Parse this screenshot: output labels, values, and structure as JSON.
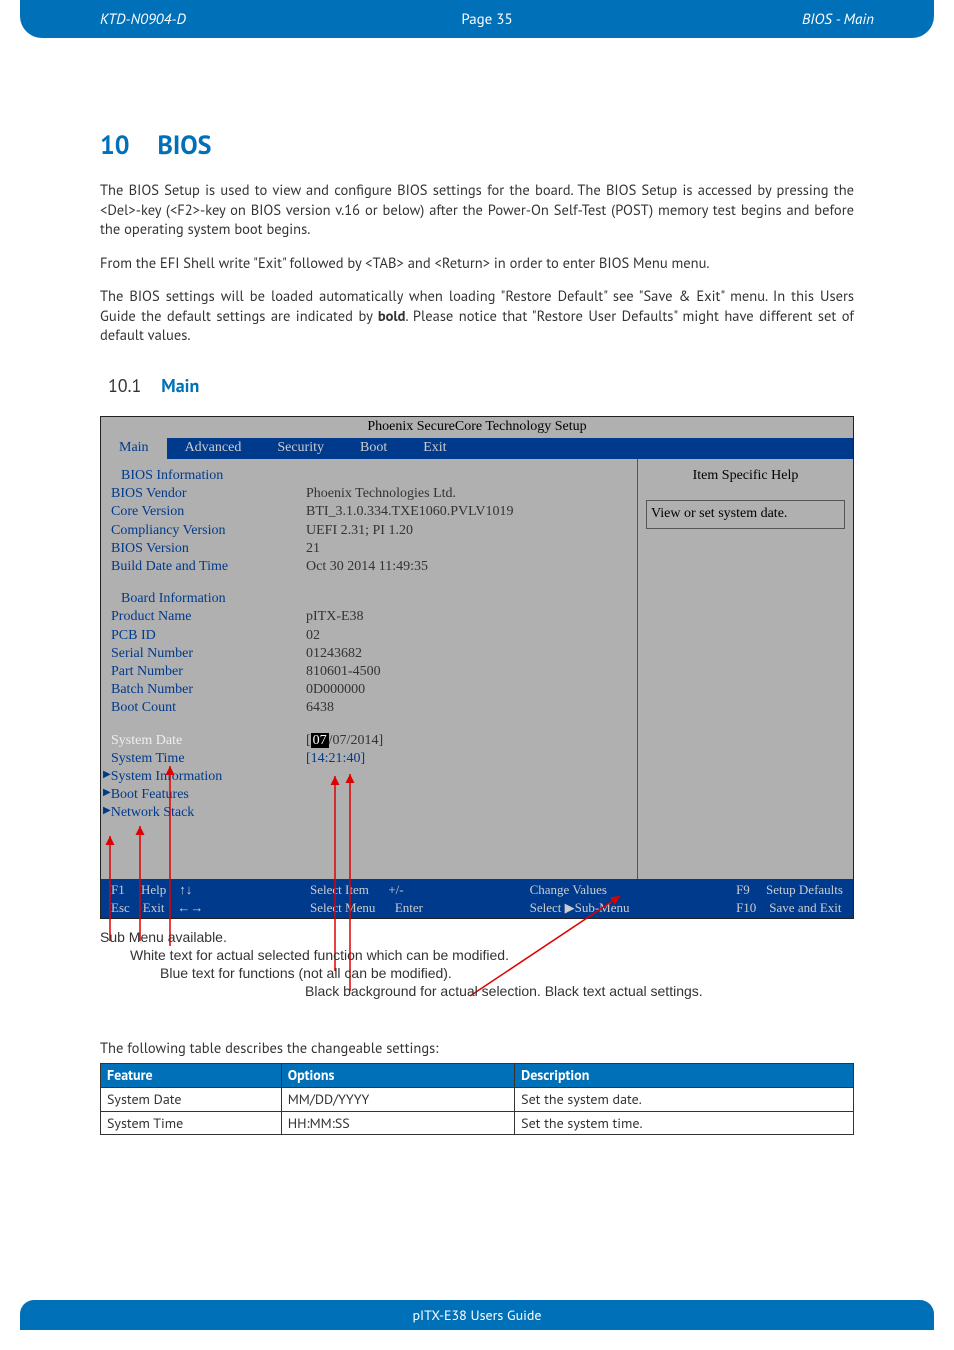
{
  "header": {
    "left": "KTD-N0904-D",
    "center": "Page 35",
    "right": "BIOS  - Main"
  },
  "section": {
    "num": "10",
    "title": "BIOS"
  },
  "para1": "The BIOS Setup is used to view and configure BIOS settings for the board. The BIOS Setup is accessed by pressing the <Del>-key (<F2>-key on BIOS version v.16 or below) after the Power-On Self-Test (POST) memory test begins and before the operating system boot begins.",
  "para2": "From the EFI Shell write \"Exit\" followed by <TAB> and <Return> in order to enter BIOS Menu menu.",
  "para3a": "The BIOS settings will be loaded automatically when loading \"Restore Default\" see \"Save & Exit\" menu. In this Users Guide the default settings are indicated by ",
  "para3b": "bold",
  "para3c": ".  Please notice that \"Restore User Defaults\" might have different set of default values.",
  "subsection": {
    "num": "10.1",
    "title": "Main"
  },
  "bios": {
    "title": "Phoenix SecureCore Technology Setup",
    "tabs": [
      "Main",
      "Advanced",
      "Security",
      "Boot",
      "Exit"
    ],
    "help_title": "Item Specific Help",
    "help_text": "View or set system date.",
    "sections": {
      "bios_info_hdr": "BIOS Information",
      "bios_vendor_l": "BIOS Vendor",
      "bios_vendor_v": "Phoenix Technologies Ltd.",
      "core_ver_l": "Core Version",
      "core_ver_v": "BTI_3.1.0.334.TXE1060.PVLV1019",
      "comp_ver_l": "Compliancy Version",
      "comp_ver_v": "UEFI 2.31; PI 1.20",
      "bios_ver_l": "BIOS Version",
      "bios_ver_v": "21",
      "build_l": "Build Date and Time",
      "build_v": "Oct  30 2014 11:49:35",
      "board_hdr": "Board Information",
      "prod_l": "Product Name",
      "prod_v": "pITX-E38",
      "pcb_l": "PCB ID",
      "pcb_v": "02",
      "sn_l": "Serial  Number",
      "sn_v": "01243682",
      "pn_l": "Part Number",
      "pn_v": "810601-4500",
      "bn_l": "Batch Number",
      "bn_v": "0D000000",
      "bc_l": "Boot Count",
      "bc_v": "6438",
      "sysdate_l": "System Date",
      "sysdate_sel": "07",
      "sysdate_rest": "/07/2014]",
      "systime_l": "System Time",
      "systime_v": "[14:21:40]",
      "sub1": "System Information",
      "sub2": "Boot Features",
      "sub3": "Network Stack"
    },
    "footer": {
      "c1a": "F1     Help    ↑↓",
      "c1b": "Esc    Exit    ←→",
      "c2a": "Select Item      +/-",
      "c2b": "Select Menu      Enter",
      "c3a": "Change Values",
      "c3b": "Select ▶Sub-Menu",
      "c4a": "F9     Setup Defaults",
      "c4b": "F10    Save and Exit"
    }
  },
  "annots": {
    "a1": "Sub Menu available.",
    "a2": "White text for actual selected function which can be modified.",
    "a3": "Blue text for functions (not all can be modified).",
    "a4": "Black background for actual selection. Black text actual settings."
  },
  "table_intro": "The following table describes the changeable settings:",
  "table": {
    "h1": "Feature",
    "h2": "Options",
    "h3": "Description",
    "r1c1": "System Date",
    "r1c2": "MM/DD/YYYY",
    "r1c3": "Set the system date.",
    "r2c1": "System Time",
    "r2c2": "HH:MM:SS",
    "r2c3": "Set the system time."
  },
  "footer": "pITX-E38 Users Guide"
}
